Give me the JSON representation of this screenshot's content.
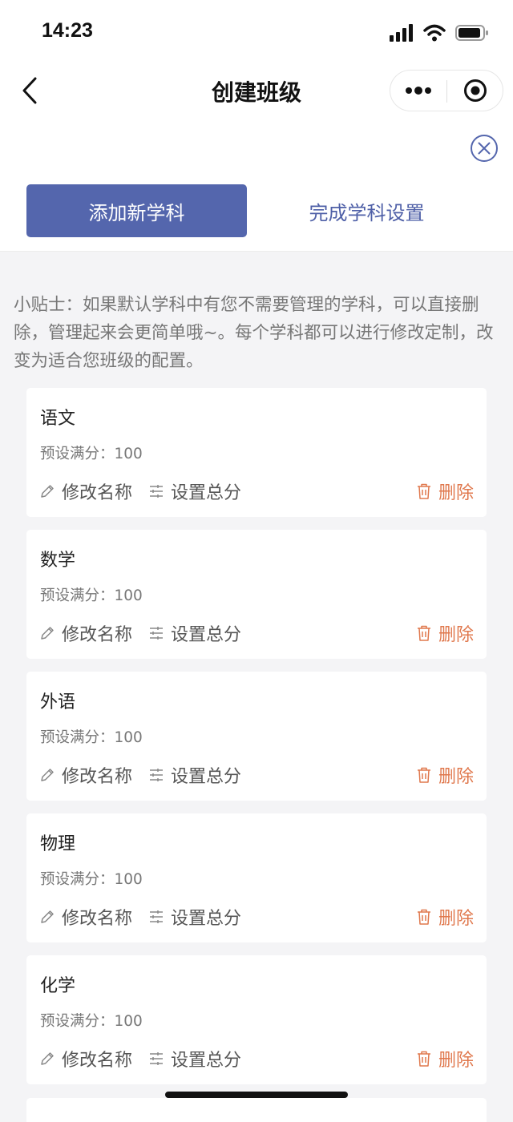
{
  "status": {
    "time": "14:23"
  },
  "nav": {
    "title": "创建班级"
  },
  "actions": {
    "add_subject": "添加新学科",
    "finish_setup": "完成学科设置"
  },
  "tip": "小贴士：如果默认学科中有您不需要管理的学科，可以直接删除，管理起来会更简单哦~。每个学科都可以进行修改定制，改变为适合您班级的配置。",
  "subjects": [
    {
      "name": "语文",
      "score_label": "预设满分：100"
    },
    {
      "name": "数学",
      "score_label": "预设满分：100"
    },
    {
      "name": "外语",
      "score_label": "预设满分：100"
    },
    {
      "name": "物理",
      "score_label": "预设满分：100"
    },
    {
      "name": "化学",
      "score_label": "预设满分：100"
    }
  ],
  "card_actions": {
    "rename": "修改名称",
    "set_total": "设置总分",
    "delete": "删除"
  },
  "colors": {
    "primary": "#5466ad",
    "link": "#4e5fa7",
    "danger": "#e0784d",
    "background": "#f4f4f6"
  },
  "icons": [
    "signal-icon",
    "wifi-icon",
    "battery-icon",
    "back-icon",
    "more-icon",
    "target-icon",
    "close-circle-icon",
    "pencil-icon",
    "sliders-icon",
    "trash-icon"
  ]
}
